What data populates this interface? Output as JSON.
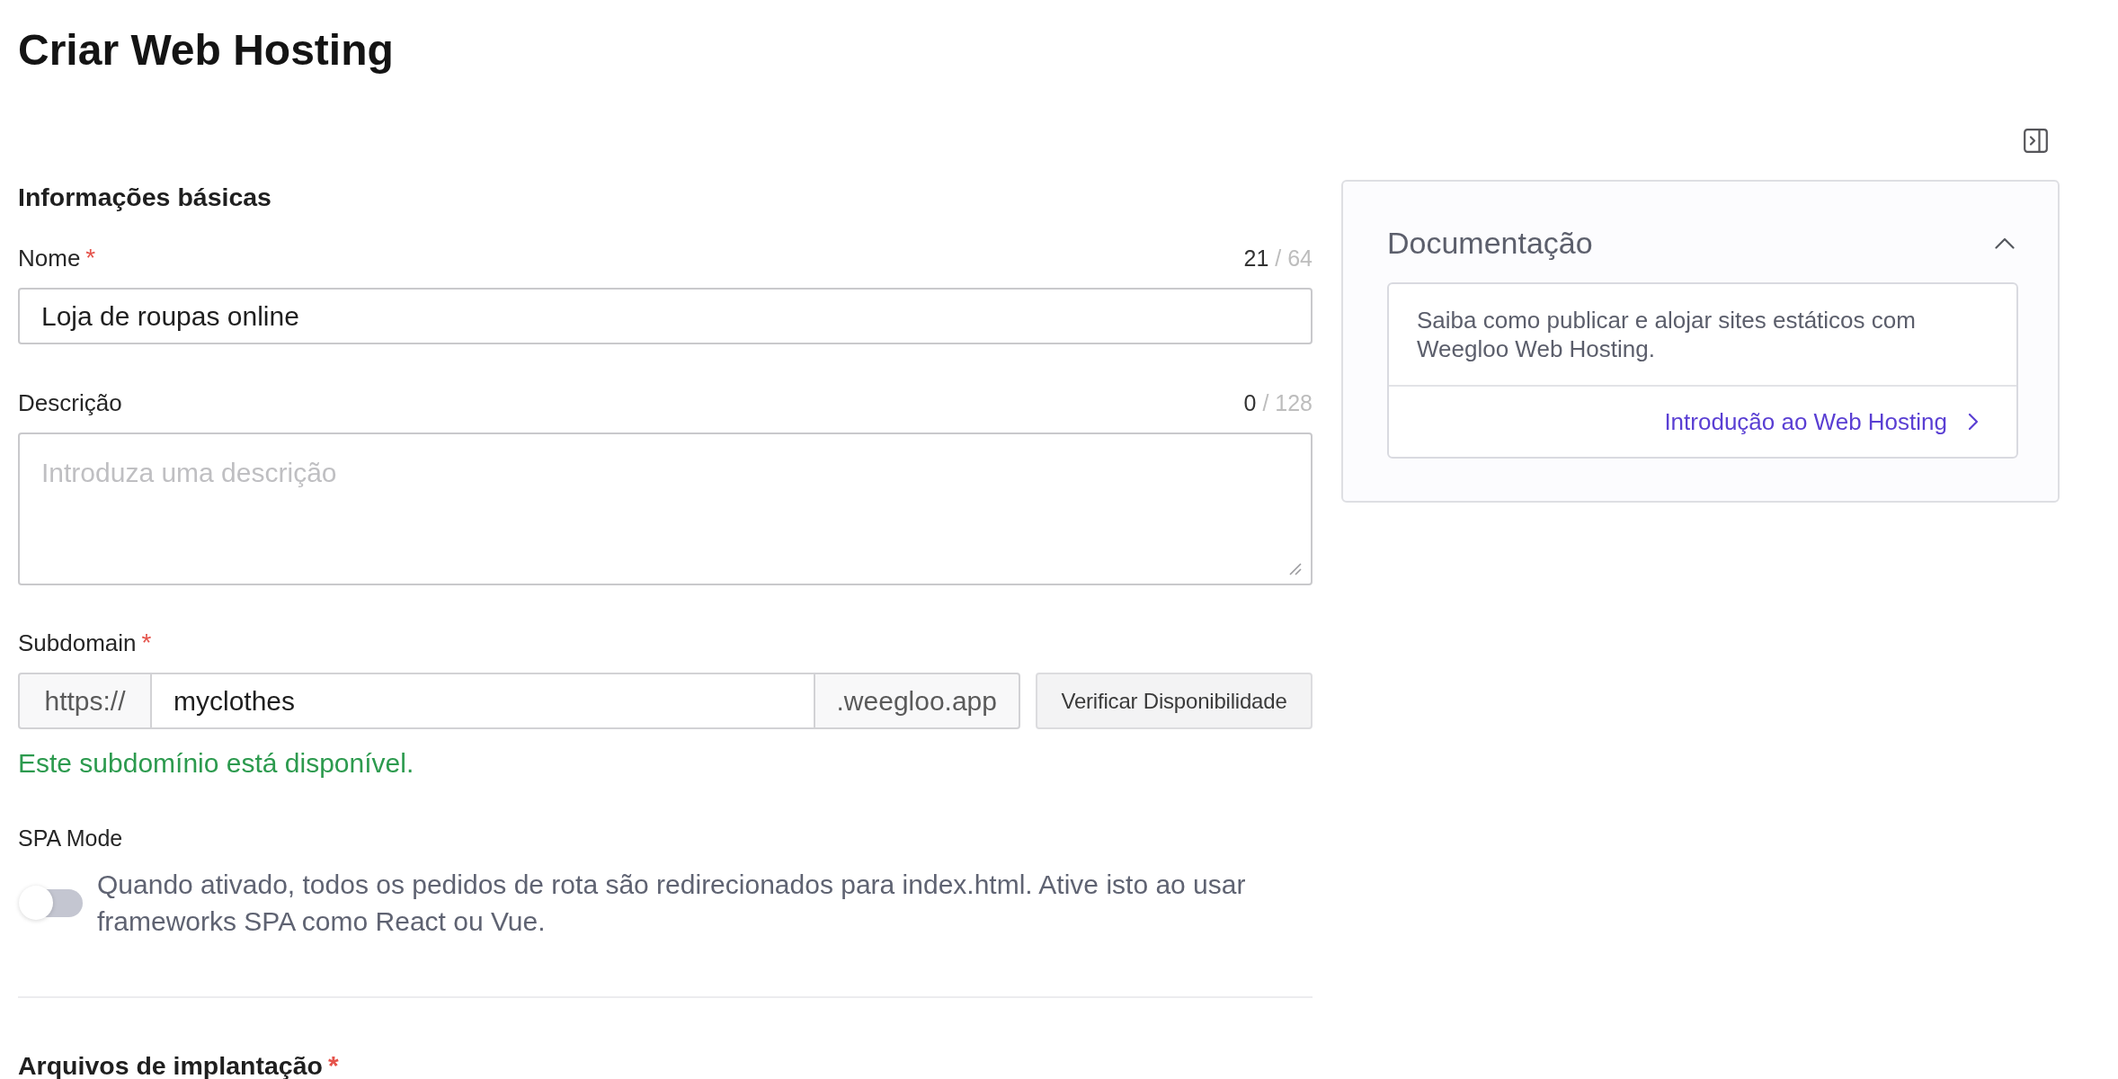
{
  "page": {
    "title": "Criar Web Hosting"
  },
  "form": {
    "section_title": "Informações básicas",
    "name": {
      "label": "Nome",
      "required_mark": "*",
      "count": "21",
      "limit": "/ 64",
      "value": "Loja de roupas online"
    },
    "description": {
      "label": "Descrição",
      "count": "0",
      "limit": "/ 128",
      "placeholder": "Introduza uma descrição"
    },
    "subdomain": {
      "label": "Subdomain",
      "required_mark": "*",
      "prefix": "https://",
      "value": "myclothes",
      "suffix": ".weegloo.app",
      "button": "Verificar Disponibilidade",
      "message": {
        "kind": "success",
        "text": "Este subdomínio está disponível."
      }
    },
    "spa_mode": {
      "label": "SPA Mode",
      "on": false,
      "description": "Quando ativado, todos os pedidos de rota são redirecionados para index.html. Ative isto ao usar frameworks SPA como React ou Vue."
    },
    "deployment": {
      "title": "Arquivos de implantação",
      "required_mark": "*"
    }
  },
  "documentation": {
    "title": "Documentação",
    "expanded": true,
    "text": "Saiba como publicar e alojar sites estáticos com Weegloo Web Hosting.",
    "link": "Introdução ao Web Hosting"
  }
}
